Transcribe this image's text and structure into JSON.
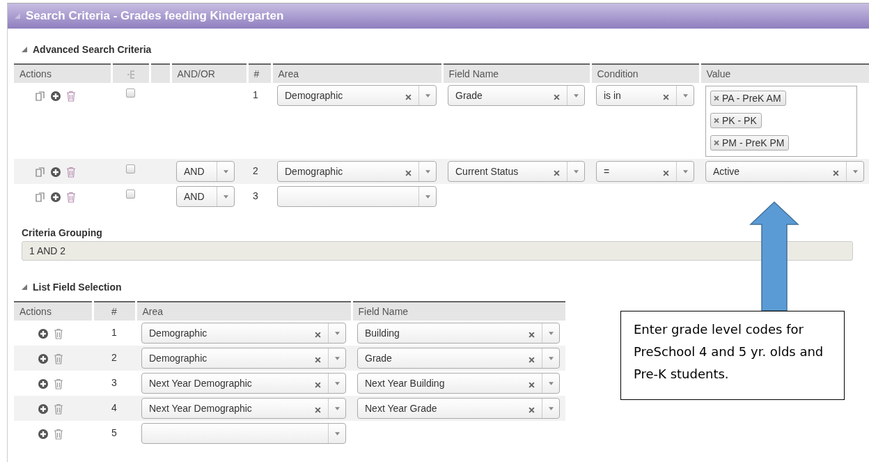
{
  "panel": {
    "title": "Search Criteria - Grades feeding Kindergarten"
  },
  "advanced": {
    "heading": "Advanced Search Criteria",
    "columns": [
      "Actions",
      "AND/OR",
      "#",
      "Area",
      "Field Name",
      "Condition",
      "Value"
    ],
    "rows": [
      {
        "number": "1",
        "checked": false,
        "area": {
          "value": "Demographic",
          "clearable": true
        },
        "field": {
          "value": "Grade",
          "clearable": true
        },
        "condition": {
          "value": "is in",
          "clearable": true
        },
        "value": {
          "kind": "tags",
          "tags": [
            "PA - PreK AM",
            "PK - PK",
            "PM - PreK PM"
          ]
        }
      },
      {
        "number": "2",
        "checked": false,
        "andor": "AND",
        "area": {
          "value": "Demographic",
          "clearable": true
        },
        "field": {
          "value": "Current Status",
          "clearable": true
        },
        "condition": {
          "value": "=",
          "clearable": true
        },
        "value": {
          "kind": "select",
          "value": "Active",
          "clearable": true
        }
      },
      {
        "number": "3",
        "checked": false,
        "andor": "AND",
        "area": {
          "clearable": false
        }
      }
    ]
  },
  "grouping": {
    "label": "Criteria Grouping",
    "value": "1 AND 2"
  },
  "list_fields": {
    "heading": "List Field Selection",
    "columns": [
      "Actions",
      "#",
      "Area",
      "Field Name"
    ],
    "rows": [
      {
        "number": "1",
        "area": {
          "value": "Demographic",
          "clearable": true
        },
        "field": {
          "value": "Building",
          "clearable": true
        }
      },
      {
        "number": "2",
        "area": {
          "value": "Demographic",
          "clearable": true
        },
        "field": {
          "value": "Grade",
          "clearable": true
        }
      },
      {
        "number": "3",
        "area": {
          "value": "Next Year Demographic",
          "clearable": true
        },
        "field": {
          "value": "Next Year Building",
          "clearable": true
        }
      },
      {
        "number": "4",
        "area": {
          "value": "Next Year Demographic",
          "clearable": true
        },
        "field": {
          "value": "Next Year Grade",
          "clearable": true
        }
      },
      {
        "number": "5",
        "area": {
          "clearable": false
        }
      }
    ]
  },
  "callout": {
    "text": "Enter grade level codes for PreSchool 4 and 5 yr. olds and Pre-K students."
  }
}
